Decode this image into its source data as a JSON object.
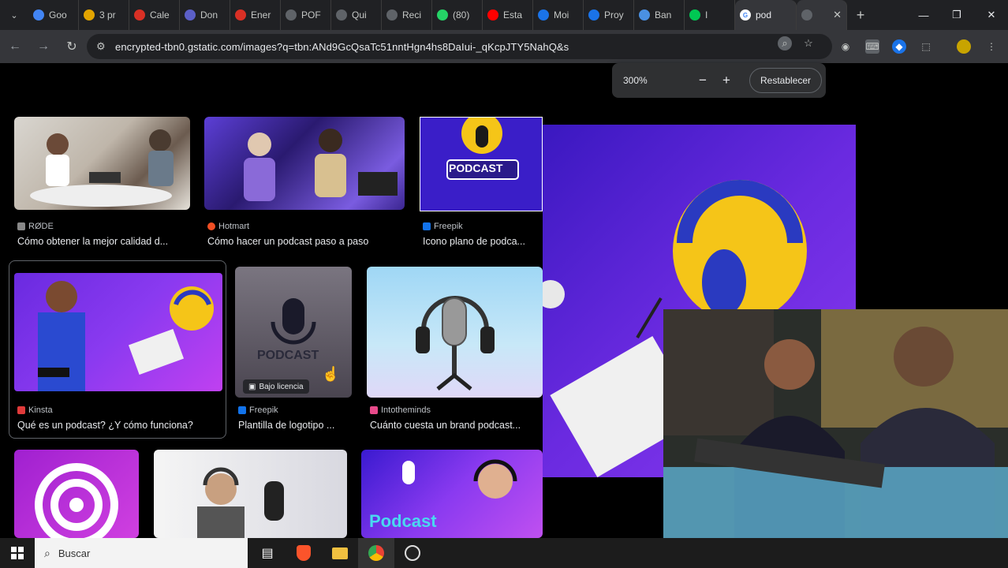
{
  "tabs": [
    {
      "label": "Goo",
      "color": "#4285f4"
    },
    {
      "label": "3 pr",
      "color": "#e2a400"
    },
    {
      "label": "Cale",
      "color": "#d93025"
    },
    {
      "label": "Don",
      "color": "#5b5fc7"
    },
    {
      "label": "Ener",
      "color": "#d93025"
    },
    {
      "label": "POF",
      "color": "#5f6368"
    },
    {
      "label": "Qui",
      "color": "#5f6368"
    },
    {
      "label": "Reci",
      "color": "#5f6368"
    },
    {
      "label": "(80)",
      "color": "#25d366"
    },
    {
      "label": "Esta",
      "color": "#ff0000"
    },
    {
      "label": "Moi",
      "color": "#1a73e8"
    },
    {
      "label": "Proy",
      "color": "#1a73e8"
    },
    {
      "label": "Ban",
      "color": "#4a90e2"
    },
    {
      "label": "I",
      "color": "#00c853"
    }
  ],
  "active_tab": {
    "label": "pod"
  },
  "address_bar": {
    "url": "encrypted-tbn0.gstatic.com/images?q=tbn:ANd9GcQsaTc51nntHgn4hs8DaIui-_qKcpJTY5NahQ&s"
  },
  "zoom_popup": {
    "level": "300%",
    "minus": "−",
    "plus": "+",
    "reset_label": "Restablecer"
  },
  "results": [
    {
      "source": "RØDE",
      "title": "Cómo obtener la mejor calidad d..."
    },
    {
      "source": "Hotmart",
      "title": "Cómo hacer un podcast paso a paso"
    },
    {
      "source": "Freepik",
      "title": "Icono plano de podca..."
    },
    {
      "source": "Kinsta",
      "title": "Qué es un podcast? ¿Y cómo funciona?"
    },
    {
      "source": "Freepik",
      "title": "Plantilla de logotipo ..."
    },
    {
      "source": "Intotheminds",
      "title": "Cuánto cuesta un brand podcast..."
    }
  ],
  "badge_label": "Bajo licencia",
  "podcast_label_1": "PODCAST",
  "podcast_label_2": "PODCAST",
  "podcast_label_3": "Podcast",
  "taskbar": {
    "search_placeholder": "Buscar"
  }
}
